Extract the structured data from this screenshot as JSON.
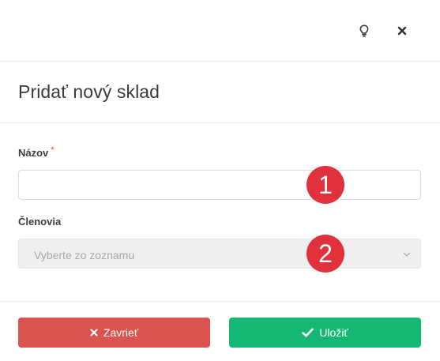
{
  "modal": {
    "title": "Pridať nový sklad"
  },
  "topbar": {
    "hint_icon": "lightbulb-icon",
    "close_icon": "close-icon"
  },
  "form": {
    "name": {
      "label": "Názov",
      "required_mark": "*",
      "value": "",
      "placeholder": ""
    },
    "members": {
      "label": "Členovia",
      "placeholder": "Vyberte zo zoznamu",
      "icon": "chevron-down-icon"
    }
  },
  "markers": [
    "1",
    "2"
  ],
  "footer": {
    "close_label": "Zavrieť",
    "close_icon": "x-icon",
    "save_label": "Uložiť",
    "save_icon": "checkmark-icon"
  },
  "colors": {
    "danger": "#d9534f",
    "success": "#14b874",
    "marker": "#e0313d",
    "required": "#e0443a"
  }
}
